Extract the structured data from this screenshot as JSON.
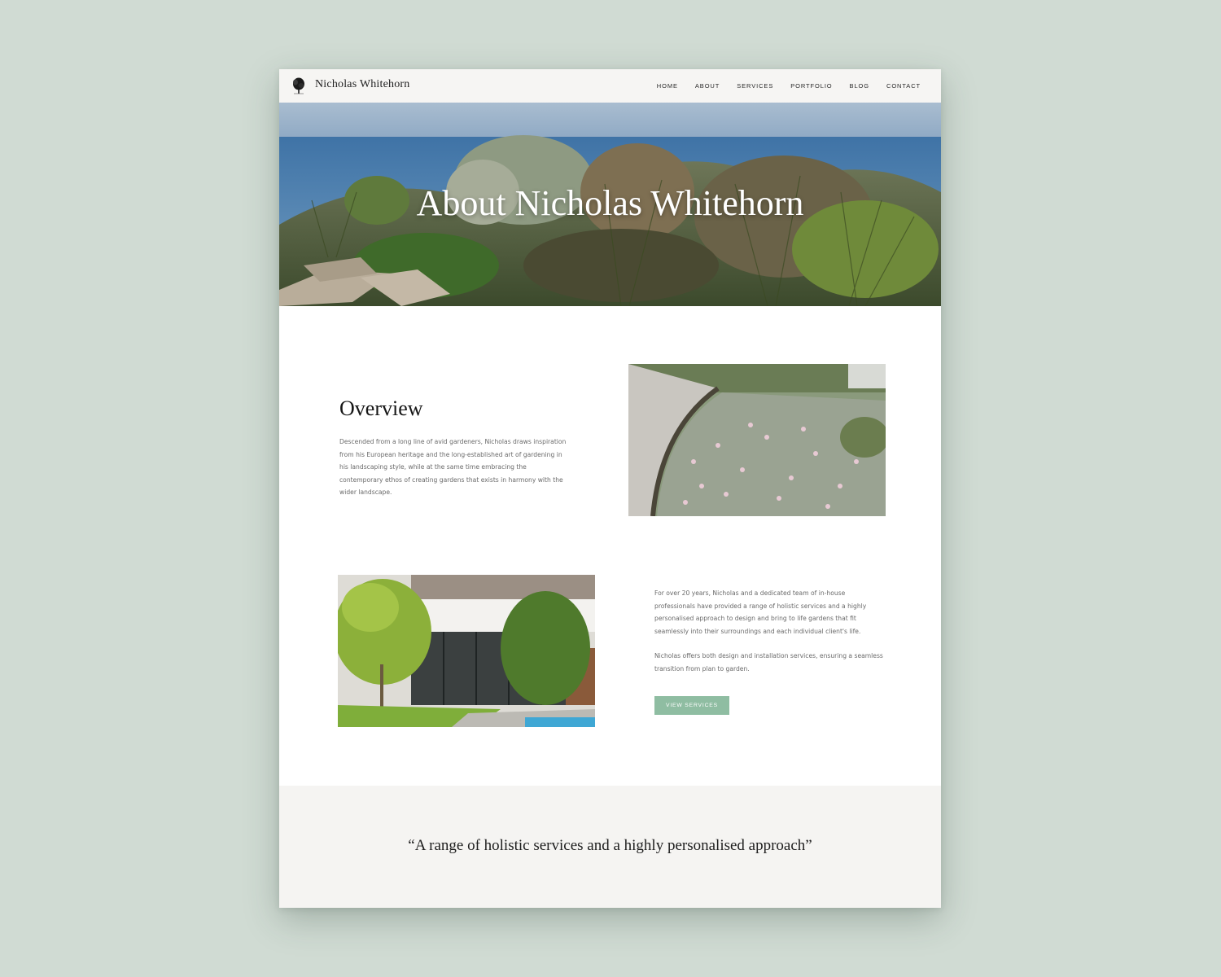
{
  "header": {
    "brand": "Nicholas Whitehorn",
    "nav": [
      "HOME",
      "ABOUT",
      "SERVICES",
      "PORTFOLIO",
      "BLOG",
      "CONTACT"
    ]
  },
  "hero": {
    "title": "About Nicholas Whitehorn"
  },
  "overview": {
    "title": "Overview",
    "paragraph": "Descended from a long line of avid gardeners, Nicholas draws inspiration from his European heritage and the long-established art of gardening in his landscaping style, while at the same time embracing the contemporary ethos of creating gardens that exists in harmony with the wider landscape."
  },
  "services": {
    "paragraph1": "For over 20 years, Nicholas and a dedicated team of in-house professionals have provided a range of holistic services and a highly personalised approach to design and bring to life gardens that fit seamlessly into their surroundings and each individual client's life.",
    "paragraph2": "Nicholas offers both design and installation services, ensuring a seamless transition from plan to garden.",
    "button_label": "VIEW SERVICES"
  },
  "quote": {
    "text": "“A range of holistic services and a highly personalised approach”"
  },
  "colors": {
    "background": "#d0dbd3",
    "header": "#f6f5f3",
    "button": "#8fbda2",
    "quote_band": "#f5f4f2"
  }
}
